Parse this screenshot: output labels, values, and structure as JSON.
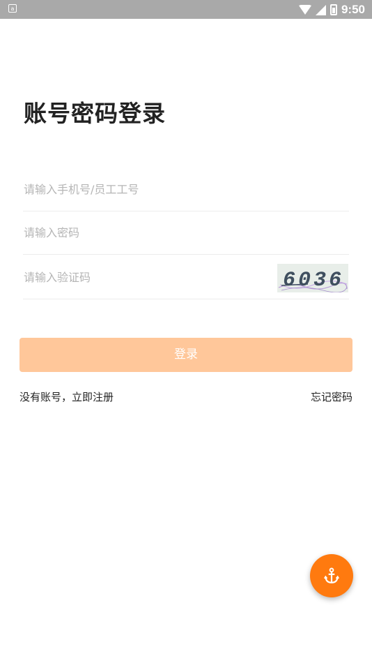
{
  "status_bar": {
    "notification_icon": "a",
    "icons": [
      "wifi-icon",
      "signal-icon",
      "battery-icon"
    ],
    "time": "9:50"
  },
  "login": {
    "title": "账号密码登录",
    "account_placeholder": "请输入手机号/员工工号",
    "password_placeholder": "请输入密码",
    "captcha_placeholder": "请输入验证码",
    "captcha_text": "6036",
    "submit_label": "登录",
    "register_link": "没有账号，立即注册",
    "forgot_link": "忘记密码"
  },
  "fab": {
    "icon": "anchor-icon"
  },
  "colors": {
    "accent": "#ff7a0f",
    "button_disabled": "#ffc79a",
    "status_bar": "#a9a9a9",
    "placeholder": "#b5b5b5"
  }
}
